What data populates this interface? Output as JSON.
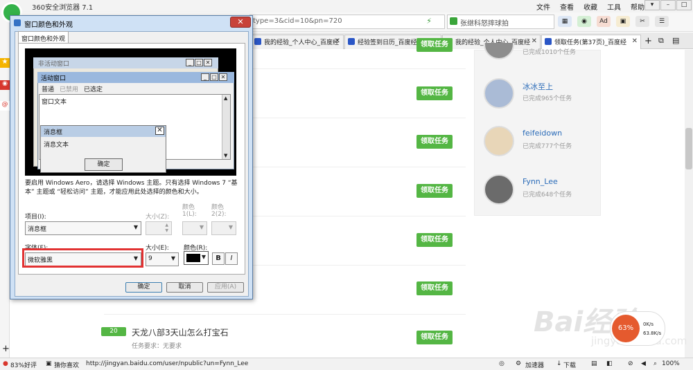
{
  "browser": {
    "title": "360安全浏览器 7.1",
    "menu": [
      "文件",
      "查看",
      "收藏",
      "工具",
      "帮助"
    ],
    "url_fragment": "type=3&cid=10&pn=720",
    "search_text": "张继科怒摔球拍",
    "status_url": "http://jingyan.baidu.com/user/npublic?un=Fynn_Lee",
    "status_left": "83%好评",
    "status_like": "猜你喜欢",
    "status_accel": "加速器",
    "status_download": "下载",
    "zoom": "100%"
  },
  "tabs": [
    {
      "label": "我的经验_个人中心_百度经"
    },
    {
      "label": "经验签到日历_百度经验"
    },
    {
      "label": "我的经验_个人中心_百度经"
    },
    {
      "label": "领取任务(第37页)_百度经"
    }
  ],
  "page": {
    "get_task_label": "领取任务",
    "users": [
      {
        "name": "冰冰至上",
        "done": "已完成965个任务"
      },
      {
        "name": "feifeidown",
        "done": "已完成777个任务"
      },
      {
        "name": "Fynn_Lee",
        "done": "已完成648个任务"
      }
    ],
    "partial_user_done": "已完成1010个任务",
    "task": {
      "badge": "20",
      "title": "天龙八部3天山怎么打宝石",
      "requirement": "任务要求：无要求"
    },
    "watermark": "Bai经验",
    "watermark_sub": "jingyan.baidu.com",
    "speed": {
      "percent": "63%",
      "up": "0K/s",
      "down": "63.8K/s"
    }
  },
  "dialog": {
    "title": "窗口颜色和外观",
    "tab": "窗口颜色和外观",
    "preview": {
      "inactive_title": "非活动窗口",
      "active_title": "活动窗口",
      "menu": [
        "普通",
        "已禁用",
        "已选定"
      ],
      "window_text": "窗口文本",
      "msgbox_title": "消息框",
      "msgbox_text": "消息文本",
      "ok": "确定"
    },
    "description": "要启用 Windows Aero，请选择 Windows 主题。只有选择 Windows 7 “基本” 主题或 “轻松访问” 主题，才能应用此处选择的颜色和大小。",
    "item_label": "项目(I):",
    "item_value": "消息框",
    "size_label": "大小(Z):",
    "color1_label": "颜色 1(L):",
    "color2_label": "颜色 2(2):",
    "font_label": "字体(F):",
    "font_value": "微软雅黑",
    "font_size_label": "大小(E):",
    "font_size_value": "9",
    "font_color_label": "颜色(R):",
    "bold": "B",
    "italic": "I",
    "ok": "确定",
    "cancel": "取消",
    "apply": "应用(A)",
    "font_color": "#000000"
  }
}
